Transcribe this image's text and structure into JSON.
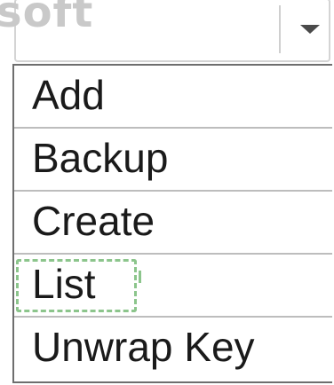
{
  "watermark": {
    "text": "soft"
  },
  "dropdown": {
    "selected_value": "",
    "icon": "chevron-down-icon",
    "options": [
      {
        "label": "Add"
      },
      {
        "label": "Backup"
      },
      {
        "label": "Create"
      },
      {
        "label": "List",
        "highlighted": true
      },
      {
        "label": "Unwrap Key"
      }
    ]
  },
  "colors": {
    "border": "#6e6e6e",
    "divider": "#bdbdbd",
    "highlight_dash": "#8cc58c",
    "watermark": "#c9c9c9"
  }
}
